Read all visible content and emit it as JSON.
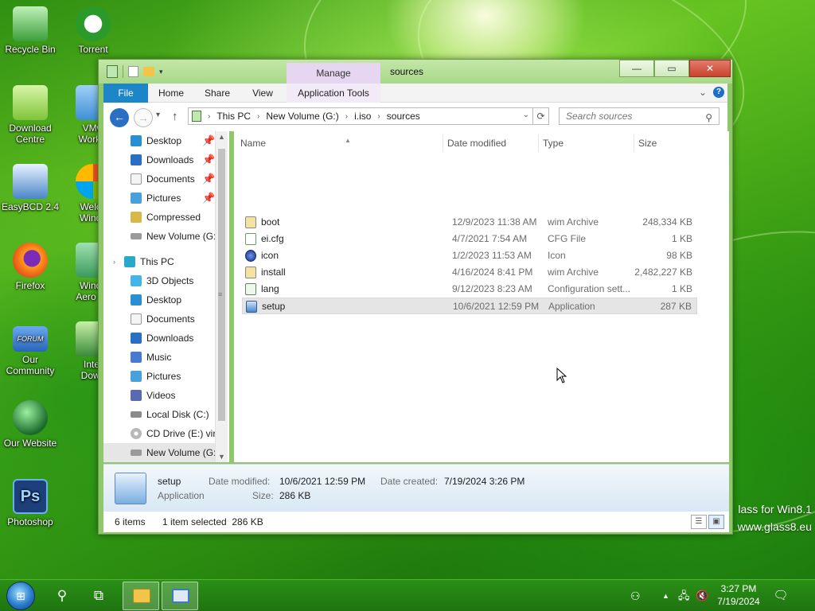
{
  "desktop": {
    "icons": [
      {
        "label": "Recycle Bin",
        "icon": "recycle-bin-icon",
        "color": "#3b9f3b"
      },
      {
        "label": "Torrent",
        "icon": "utorrent-icon",
        "color": "#2a9a2a"
      },
      {
        "label": "Download\nCentre",
        "icon": "download-centre-icon",
        "color": "#8fd24a"
      },
      {
        "label": "VMw\nWorkst",
        "icon": "vmware-icon",
        "color": "#3f8fd6"
      },
      {
        "label": "EasyBCD 2.4",
        "icon": "easybcd-icon",
        "color": "#4a86c8"
      },
      {
        "label": "Welco\nWindo",
        "icon": "welcome-windows-icon",
        "color": "#f0c020"
      },
      {
        "label": "Firefox",
        "icon": "firefox-icon",
        "color": "#e86a1a"
      },
      {
        "label": "Windo\nAero Ed",
        "icon": "aero-editor-icon",
        "color": "#3a9a5a"
      },
      {
        "label": "Our\nCommunity",
        "icon": "forum-icon",
        "color": "#2a66b8"
      },
      {
        "label": "Inter\nDown",
        "icon": "internet-download-icon",
        "color": "#3a8a3a"
      },
      {
        "label": "Our Website",
        "icon": "globe-icon",
        "color": "#1a6a2a"
      },
      {
        "label": "Photoshop",
        "icon": "photoshop-icon",
        "color": "#1d3f7a"
      }
    ],
    "watermark_line1": "lass for Win8.1",
    "watermark_line2": "www.glass8.eu"
  },
  "window": {
    "title": "sources",
    "contextual_group": "Manage",
    "controls": {
      "minimize": "—",
      "maximize": "▭",
      "close": "✕"
    },
    "ribbon_tabs": [
      "File",
      "Home",
      "Share",
      "View",
      "Application Tools"
    ],
    "ribbon_expand": "⌄",
    "help": "?"
  },
  "navbar": {
    "back": "←",
    "forward": "→",
    "recent": "▾",
    "up": "↑",
    "breadcrumb": [
      "This PC",
      "New Volume (G:)",
      "i.iso",
      "sources"
    ],
    "search_placeholder": "Search sources"
  },
  "nav_pane": {
    "quick_access": [
      {
        "label": "Desktop",
        "icon": "desktop-icon",
        "color": "#2a8fd0",
        "pinned": true
      },
      {
        "label": "Downloads",
        "icon": "downloads-icon",
        "color": "#2a6fc2",
        "pinned": true
      },
      {
        "label": "Documents",
        "icon": "documents-icon",
        "color": "#d8d8d8",
        "pinned": true
      },
      {
        "label": "Pictures",
        "icon": "pictures-icon",
        "color": "#4aa0d8",
        "pinned": true
      },
      {
        "label": "Compressed",
        "icon": "compressed-folder-icon",
        "color": "#d8b84a",
        "pinned": false
      },
      {
        "label": "New Volume (G:",
        "icon": "drive-icon",
        "color": "#9a9a9a",
        "pinned": false
      }
    ],
    "this_pc_label": "This PC",
    "this_pc": [
      {
        "label": "3D Objects",
        "icon": "3d-objects-icon",
        "color": "#46b4e8"
      },
      {
        "label": "Desktop",
        "icon": "desktop-icon",
        "color": "#2a8fd0"
      },
      {
        "label": "Documents",
        "icon": "documents-icon",
        "color": "#d8d8d8"
      },
      {
        "label": "Downloads",
        "icon": "downloads-icon",
        "color": "#2a6fc2"
      },
      {
        "label": "Music",
        "icon": "music-icon",
        "color": "#4a7ad0"
      },
      {
        "label": "Pictures",
        "icon": "pictures-icon",
        "color": "#4aa0d8"
      },
      {
        "label": "Videos",
        "icon": "videos-icon",
        "color": "#5a6ab0"
      },
      {
        "label": "Local Disk (C:)",
        "icon": "local-disk-icon",
        "color": "#8a8a8a"
      },
      {
        "label": "CD Drive (E:) virt",
        "icon": "cd-drive-icon",
        "color": "#b8b8b8"
      },
      {
        "label": "New Volume (G:",
        "icon": "drive-icon",
        "color": "#9a9a9a"
      }
    ]
  },
  "file_list": {
    "columns": [
      "Name",
      "Date modified",
      "Type",
      "Size"
    ],
    "rows": [
      {
        "name": "boot",
        "date": "12/9/2023 11:38 AM",
        "type": "wim Archive",
        "size": "248,334 KB",
        "icon": "wim-archive-icon",
        "color": "#e8c24a",
        "selected": false
      },
      {
        "name": "ei.cfg",
        "date": "4/7/2021 7:54 AM",
        "type": "CFG File",
        "size": "1 KB",
        "icon": "cfg-file-icon",
        "color": "#ffffff",
        "selected": false
      },
      {
        "name": "icon",
        "date": "1/2/2023 11:53 AM",
        "type": "Icon",
        "size": "98 KB",
        "icon": "icon-file-icon",
        "color": "#2a4a9a",
        "selected": false
      },
      {
        "name": "install",
        "date": "4/16/2024 8:41 PM",
        "type": "wim Archive",
        "size": "2,482,227 KB",
        "icon": "wim-archive-icon",
        "color": "#e8c24a",
        "selected": false
      },
      {
        "name": "lang",
        "date": "9/12/2023 8:23 AM",
        "type": "Configuration sett...",
        "size": "1 KB",
        "icon": "config-file-icon",
        "color": "#ffffff",
        "selected": false
      },
      {
        "name": "setup",
        "date": "10/6/2021 12:59 PM",
        "type": "Application",
        "size": "287 KB",
        "icon": "setup-app-icon",
        "color": "#4a86c8",
        "selected": true
      }
    ]
  },
  "details_pane": {
    "name": "setup",
    "type": "Application",
    "modified_label": "Date modified:",
    "modified_value": "10/6/2021 12:59 PM",
    "created_label": "Date created:",
    "created_value": "7/19/2024 3:26 PM",
    "size_label": "Size:",
    "size_value": "286 KB"
  },
  "status_bar": {
    "items": "6 items",
    "selection": "1 item selected  286 KB"
  },
  "taskbar": {
    "start": "⊞",
    "search": "⚲",
    "task_view": "⧉",
    "apps": [
      {
        "name": "File Explorer",
        "icon": "file-explorer-icon",
        "color": "#f2c44a"
      },
      {
        "name": "Control Panel",
        "icon": "control-panel-icon",
        "color": "#3a7ac8"
      }
    ],
    "tray": {
      "people": "⚇",
      "overflow": "▲",
      "network": "🖧",
      "volume": "🔇"
    },
    "time": "3:27 PM",
    "date": "7/19/2024",
    "notifications": "🗨"
  },
  "colors": {
    "accent": "#1c86c8",
    "contextual": "#e7d6f2",
    "selection": "#e5e5e5"
  }
}
